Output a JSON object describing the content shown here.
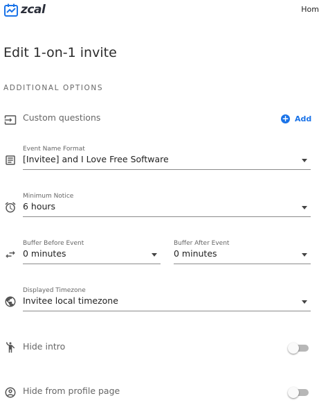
{
  "header": {
    "logo_text": "zcal",
    "nav_home": "Hom"
  },
  "page": {
    "title": "Edit 1-on-1 invite",
    "section_heading": "ADDITIONAL OPTIONS"
  },
  "custom_questions": {
    "label": "Custom questions",
    "add_label": "Add",
    "add_icon": "+"
  },
  "event_name_format": {
    "label": "Event Name Format",
    "value": "[Invitee] and I Love Free Software"
  },
  "minimum_notice": {
    "label": "Minimum Notice",
    "value": "6 hours"
  },
  "buffer_before": {
    "label": "Buffer Before Event",
    "value": "0 minutes"
  },
  "buffer_after": {
    "label": "Buffer After Event",
    "value": "0 minutes"
  },
  "displayed_timezone": {
    "label": "Displayed Timezone",
    "value": "Invitee local timezone"
  },
  "hide_intro": {
    "label": "Hide intro",
    "enabled": false
  },
  "hide_from_profile": {
    "label": "Hide from profile page",
    "enabled": false
  },
  "colors": {
    "accent": "#1a73e8",
    "logo": "#1a73e8",
    "text": "#2a2a2a",
    "muted": "#666666"
  },
  "icons": {
    "logo": "calendar-logo-icon",
    "custom_questions": "input-arrow-icon",
    "event_name_format": "notes-icon",
    "minimum_notice": "alarm-clock-icon",
    "buffer": "swap-arrows-icon",
    "timezone": "globe-icon",
    "hide_intro": "person-wave-icon",
    "hide_from_profile": "account-circle-icon"
  }
}
